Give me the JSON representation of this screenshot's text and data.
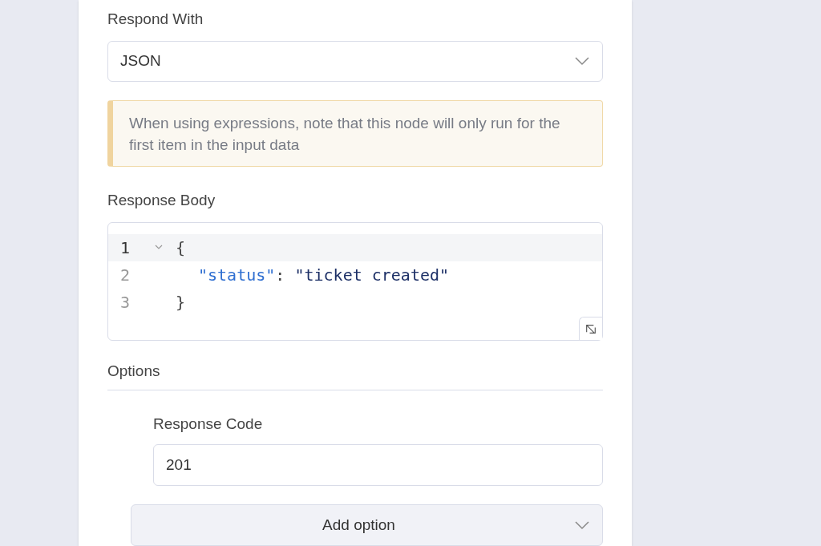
{
  "respond_with": {
    "label": "Respond With",
    "value": "JSON"
  },
  "notice": {
    "text": "When using expressions, note that this node will only run for the first item in the input data"
  },
  "response_body": {
    "label": "Response Body",
    "lines": [
      {
        "number": "1",
        "active": true,
        "foldable": true,
        "indented": false,
        "tokens": [
          {
            "text": "{",
            "kind": "punct"
          }
        ]
      },
      {
        "number": "2",
        "active": false,
        "foldable": false,
        "indented": true,
        "tokens": [
          {
            "text": "\"status\"",
            "kind": "key"
          },
          {
            "text": ": ",
            "kind": "punct"
          },
          {
            "text": "\"ticket created\"",
            "kind": "string"
          }
        ]
      },
      {
        "number": "3",
        "active": false,
        "foldable": false,
        "indented": false,
        "tokens": [
          {
            "text": "}",
            "kind": "punct"
          }
        ]
      }
    ]
  },
  "options": {
    "title": "Options",
    "fields": [
      {
        "label": "Response Code",
        "value": "201"
      }
    ],
    "add_button": "Add option"
  }
}
